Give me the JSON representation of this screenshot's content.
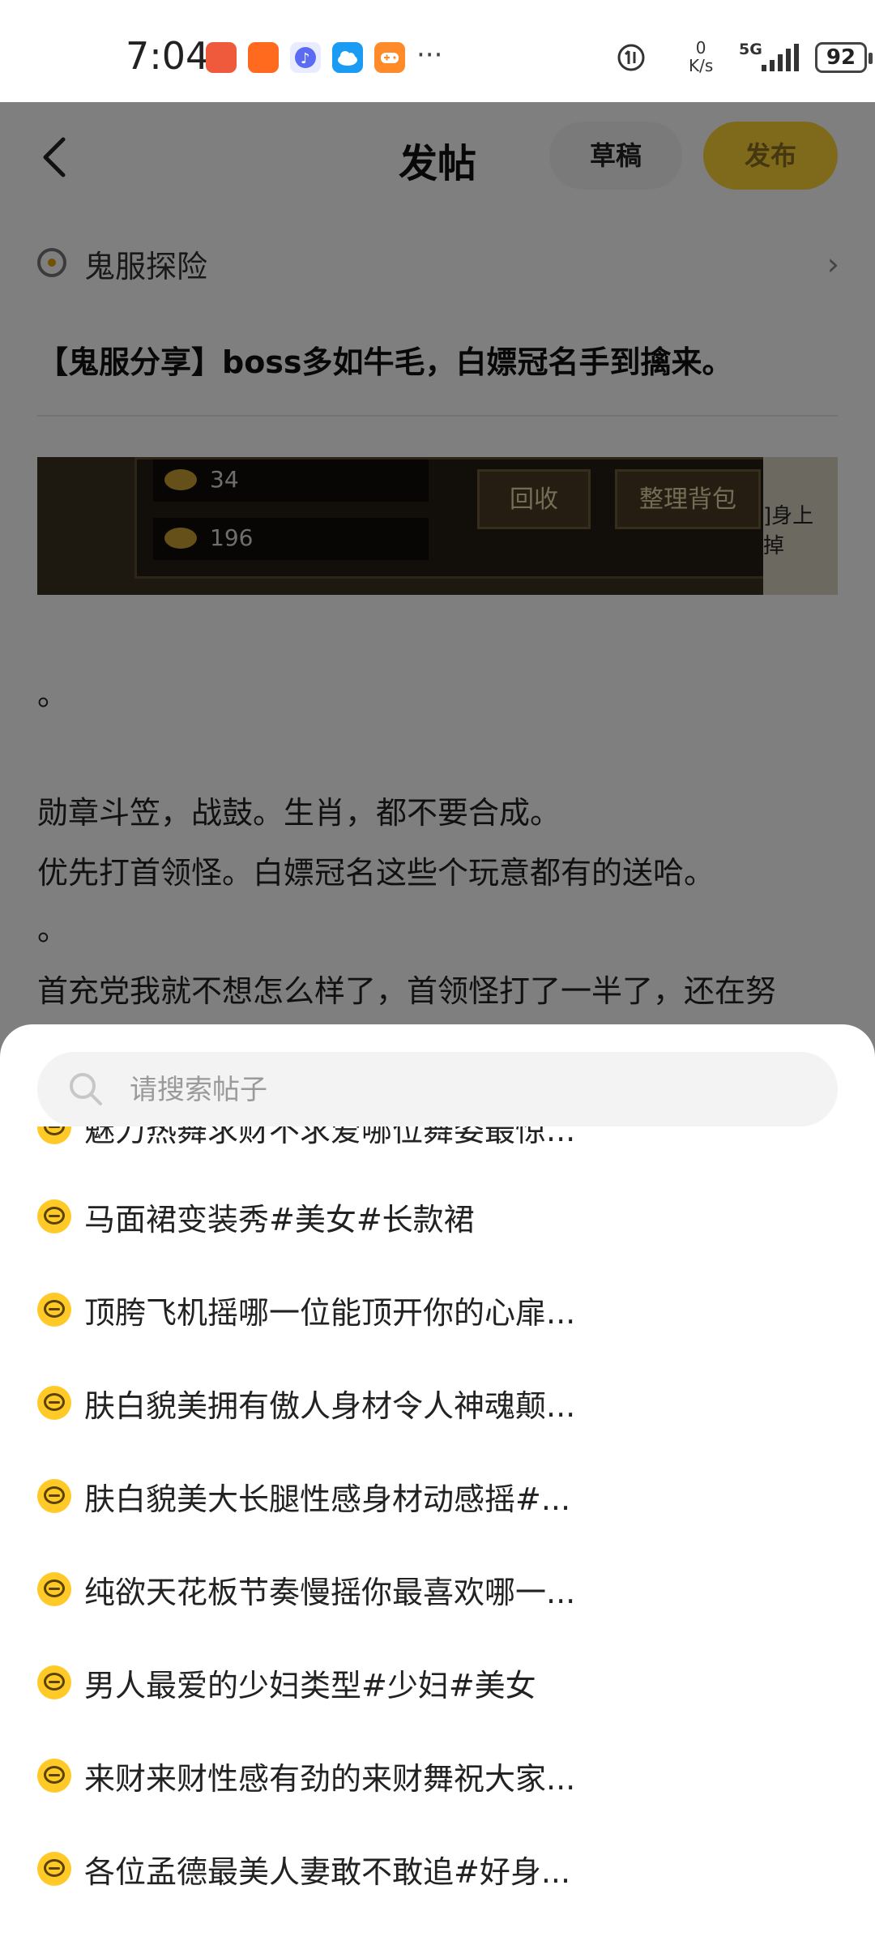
{
  "status_bar": {
    "time": "7:04",
    "net_speed_value": "0",
    "net_speed_unit": "K/s",
    "network": "5G",
    "battery": "92",
    "more": "···",
    "app_icons": [
      "phone-missed-icon",
      "kuaishou-icon",
      "music-icon",
      "cloud-icon",
      "game-center-icon"
    ]
  },
  "header": {
    "title": "发帖",
    "draft_label": "草稿",
    "publish_label": "发布"
  },
  "circle": {
    "name": "鬼服探险"
  },
  "post": {
    "title": "【鬼服分享】boss多如牛毛，白嫖冠名手到擒来。",
    "image": {
      "gold_1": "34",
      "gold_2": "196",
      "btn_recycle": "回收",
      "btn_sort": "整理背包",
      "side_text": "]身上掉"
    },
    "lines": [
      "。",
      "勋章斗笠，战鼓。生肖，都不要合成。",
      "优先打首领怪。白嫖冠名这些个玩意都有的送哈。",
      "。",
      "首充党我就不想怎么样了，首领怪打了一半了，还在努"
    ]
  },
  "search": {
    "placeholder": "请搜索帖子"
  },
  "results": [
    "魅力热舞求财不求爱哪位舞姿最惊...",
    "马面裙变装秀#美女#长款裙",
    "顶胯飞机摇哪一位能顶开你的心扉...",
    "肤白貌美拥有傲人身材令人神魂颠...",
    "肤白貌美大长腿性感身材动感摇#...",
    "纯欲天花板节奏慢摇你最喜欢哪一...",
    "男人最爱的少妇类型#少妇#美女",
    "来财来财性感有劲的来财舞祝大家...",
    "各位孟德最美人妻敢不敢追#好身..."
  ]
}
